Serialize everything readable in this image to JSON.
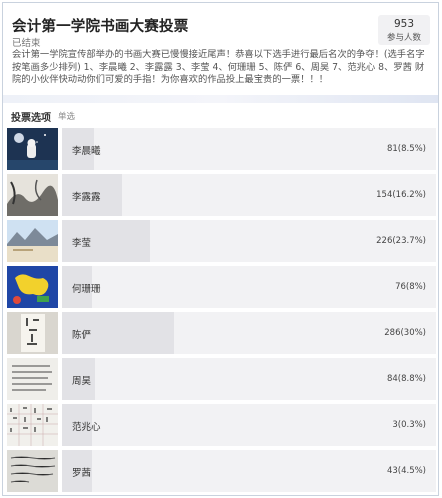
{
  "header": {
    "title": "会计第一学院书画大赛投票",
    "status": "已结束",
    "description": "会计第一学院宣传部举办的书画大赛已慢慢接近尾声！恭喜以下选手进行最后名次的争夺！(选手名字按笔画多少排列) 1、李晨曦 2、李露露 3、李莹 4、何珊珊 5、陈俨 6、周昊 7、范兆心 8、罗茜 财院的小伙伴快动动你们可爱的手指！为你喜欢的作品投上最宝贵的一票！！！",
    "participants_count": "953",
    "participants_label": "参与人数"
  },
  "section": {
    "title": "投票选项",
    "type": "单选"
  },
  "options": [
    {
      "name": "李晨曦",
      "stat": "81(8.5%)",
      "percent": 8.5,
      "thumb_icon": "night-sky-astronaut-painting"
    },
    {
      "name": "李露露",
      "stat": "154(16.2%)",
      "percent": 16.2,
      "thumb_icon": "ink-landscape-painting"
    },
    {
      "name": "李莹",
      "stat": "226(23.7%)",
      "percent": 23.7,
      "thumb_icon": "mountain-lake-painting"
    },
    {
      "name": "何珊珊",
      "stat": "76(8%)",
      "percent": 8.0,
      "thumb_icon": "yellow-map-blue-painting"
    },
    {
      "name": "陈俨",
      "stat": "286(30%)",
      "percent": 30.0,
      "thumb_icon": "calligraphy-scroll"
    },
    {
      "name": "周昊",
      "stat": "84(8.8%)",
      "percent": 8.8,
      "thumb_icon": "handwriting-sheet"
    },
    {
      "name": "范兆心",
      "stat": "3(0.3%)",
      "percent": 0.3,
      "thumb_icon": "calligraphy-grid-sheet"
    },
    {
      "name": "罗茜",
      "stat": "43(4.5%)",
      "percent": 4.5,
      "thumb_icon": "handwritten-text-photo"
    }
  ]
}
